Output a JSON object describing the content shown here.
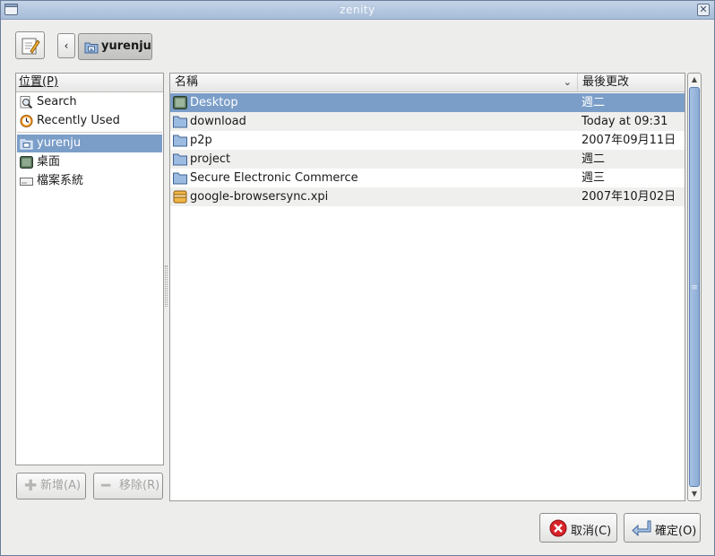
{
  "window": {
    "title": "zenity"
  },
  "toolbar": {
    "path_button_label": "yurenju"
  },
  "places": {
    "header": "位置(P)",
    "items": [
      {
        "label": "Search",
        "icon": "search-icon"
      },
      {
        "label": "Recently Used",
        "icon": "recent-icon"
      },
      {
        "label": "yurenju",
        "icon": "home-folder-icon",
        "selected": true
      },
      {
        "label": "桌面",
        "icon": "desktop-icon"
      },
      {
        "label": "檔案系統",
        "icon": "drive-icon"
      }
    ],
    "add_label": "新增(A)",
    "remove_label": "移除(R)"
  },
  "files": {
    "name_header": "名稱",
    "date_header": "最後更改",
    "rows": [
      {
        "name": "Desktop",
        "date": "週二",
        "icon": "desktop-icon",
        "selected": true
      },
      {
        "name": "download",
        "date": "Today at 09:31",
        "icon": "folder-icon"
      },
      {
        "name": "p2p",
        "date": "2007年09月11日",
        "icon": "folder-icon"
      },
      {
        "name": "project",
        "date": "週二",
        "icon": "folder-icon"
      },
      {
        "name": "Secure Electronic Commerce",
        "date": "週三",
        "icon": "folder-icon"
      },
      {
        "name": "google-browsersync.xpi",
        "date": "2007年10月02日",
        "icon": "package-icon"
      }
    ]
  },
  "buttons": {
    "cancel_label": "取消(C)",
    "ok_label": "確定(O)"
  },
  "colors": {
    "selection": "#7b9ec9",
    "titlebar": "#b4c6de"
  }
}
